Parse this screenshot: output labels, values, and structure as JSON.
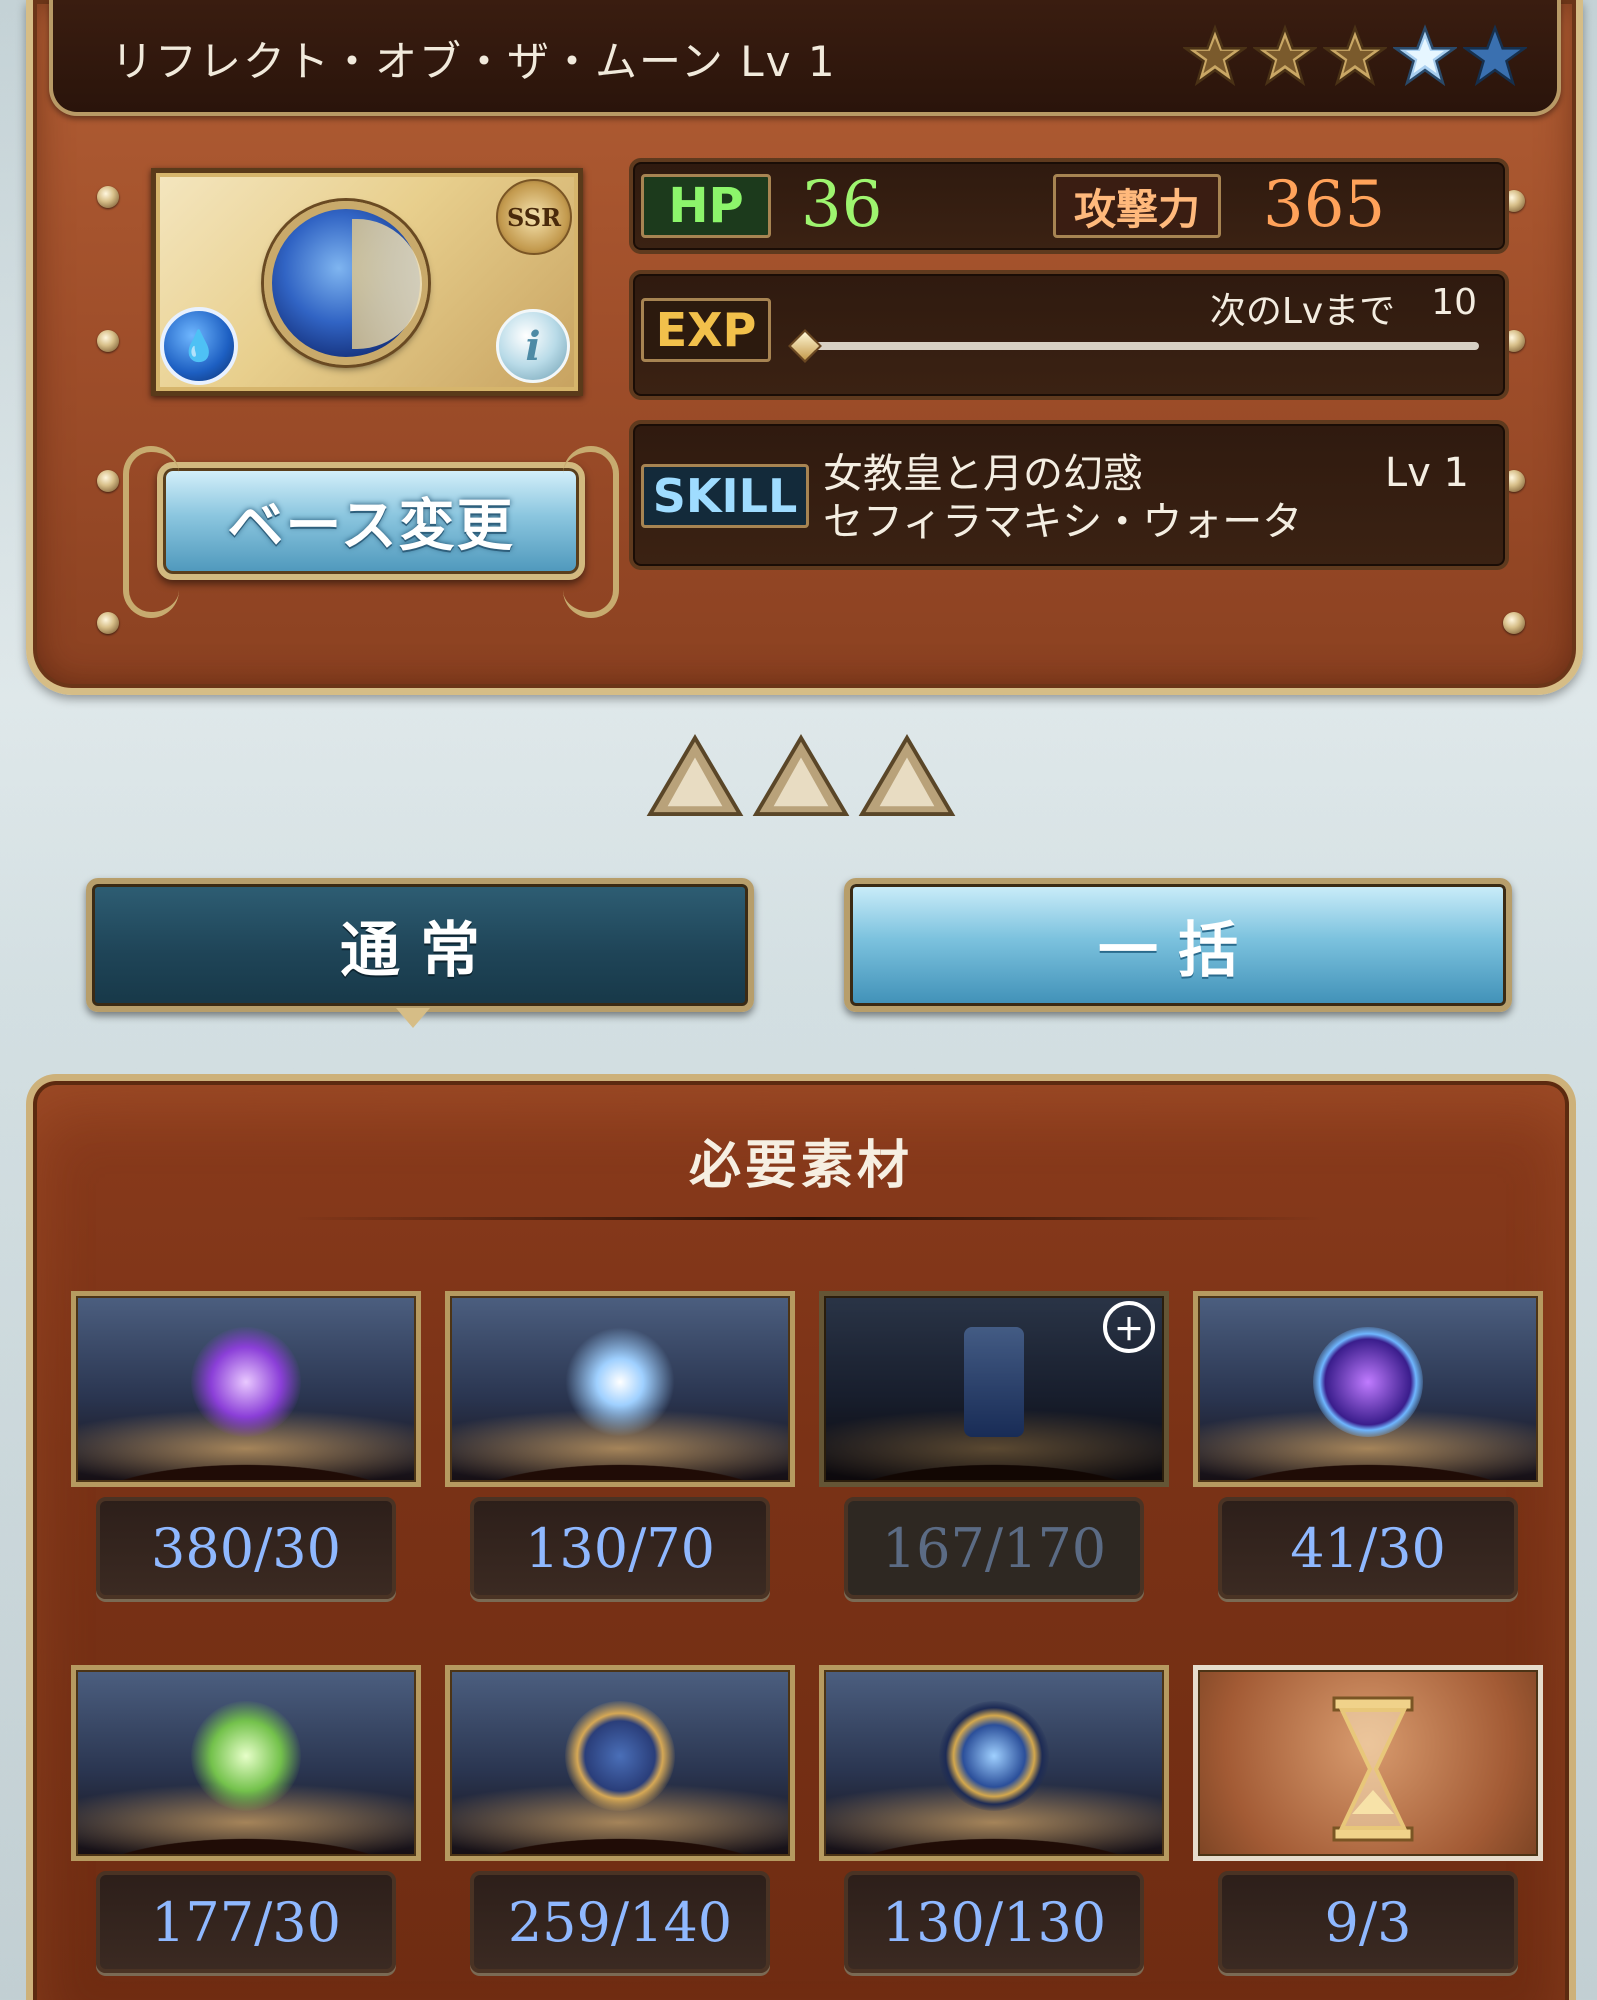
{
  "title": "リフレクト・オブ・ザ・ムーン Lv 1",
  "stars": [
    {
      "state": "filled-gold",
      "icon": "star-icon"
    },
    {
      "state": "filled-gold",
      "icon": "star-icon"
    },
    {
      "state": "filled-gold",
      "icon": "star-icon"
    },
    {
      "state": "current-blue",
      "icon": "star-icon"
    },
    {
      "state": "empty-blue",
      "icon": "star-icon"
    }
  ],
  "character": {
    "rarity": "SSR",
    "element_icon": "water-element-icon",
    "info_icon": "info-icon",
    "info_glyph": "i",
    "element_glyph": "💧"
  },
  "base_change_label": "ベース変更",
  "stats": {
    "hp_label": "HP",
    "hp_value": "36",
    "atk_label": "攻撃力",
    "atk_value": "365"
  },
  "exp": {
    "label": "EXP",
    "next_label": "次のLvまで",
    "next_value": "10",
    "progress": 0
  },
  "skill": {
    "label": "SKILL",
    "name_line1": "女教皇と月の幻惑",
    "name_line2": "セフィラマキシ・ウォータ",
    "level": "Lv 1"
  },
  "tabs": {
    "normal": "通常",
    "bulk": "一括"
  },
  "materials": {
    "title": "必要素材",
    "items": [
      {
        "count": "380/30",
        "icon": "purple-crystal-icon",
        "available": true
      },
      {
        "count": "130/70",
        "icon": "star-burst-icon",
        "available": true
      },
      {
        "count": "167/170",
        "icon": "blue-scroll-icon",
        "available": false
      },
      {
        "count": "41/30",
        "icon": "ringed-orb-icon",
        "available": true
      },
      {
        "count": "177/30",
        "icon": "green-hexagon-icon",
        "available": true
      },
      {
        "count": "259/140",
        "icon": "golden-astrolabe-icon",
        "available": true
      },
      {
        "count": "130/130",
        "icon": "galaxy-medallion-icon",
        "available": true
      },
      {
        "count": "9/3",
        "icon": "hourglass-icon",
        "available": true
      }
    ]
  },
  "colors": {
    "panel_brown": "#9f4e2a",
    "hp_green": "#9ef56f",
    "atk_orange": "#ffa25a",
    "count_blue": "#8fb8ff",
    "gold_trim": "#d6bd86"
  }
}
